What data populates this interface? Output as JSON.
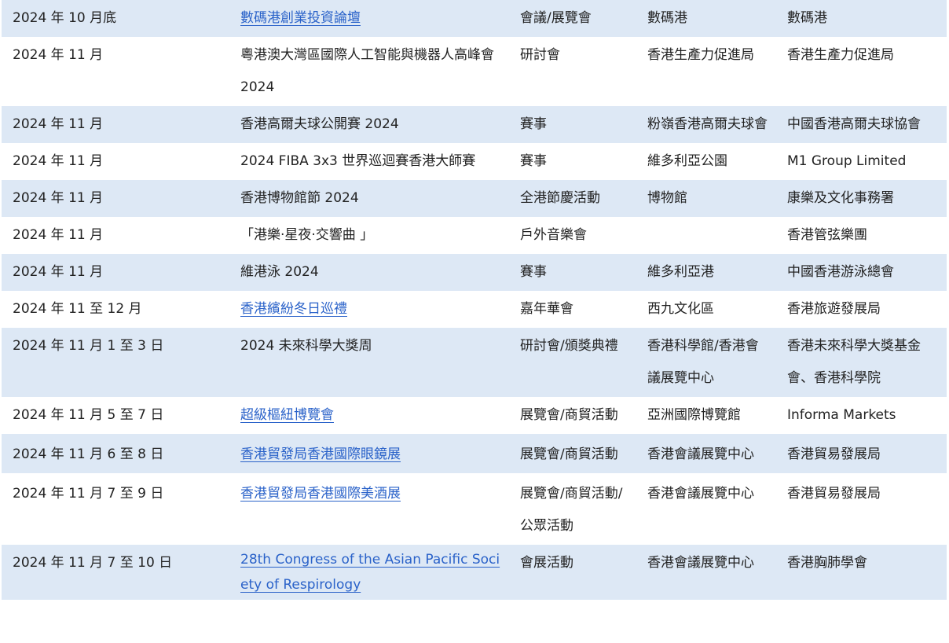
{
  "rows": [
    {
      "date": "2024 年 10 月底",
      "event": "數碼港創業投資論壇",
      "link": true,
      "type": "會議/展覽會",
      "venue": "數碼港",
      "organizer": "數碼港"
    },
    {
      "date": "2024 年 11 月",
      "event": "粵港澳大灣區國際人工智能與機器人高峰會 2024",
      "link": false,
      "type": "研討會",
      "venue": "香港生產力促進局",
      "organizer": "香港生產力促進局"
    },
    {
      "date": "2024 年 11 月",
      "event": "香港高爾夫球公開賽 2024",
      "link": false,
      "type": "賽事",
      "venue": "粉嶺香港高爾夫球會",
      "organizer": "中國香港高爾夫球協會"
    },
    {
      "date": "2024 年 11 月",
      "event": "2024 FIBA 3x3 世界巡迴賽香港大師賽",
      "link": false,
      "type": "賽事",
      "venue": "維多利亞公園",
      "organizer": "M1 Group Limited"
    },
    {
      "date": "2024 年 11 月",
      "event": "香港博物館節 2024",
      "link": false,
      "type": "全港節慶活動",
      "venue": "博物館",
      "organizer": "康樂及文化事務署"
    },
    {
      "date": "2024 年 11 月",
      "event": "「港樂‧星夜‧交響曲 」",
      "link": false,
      "type": "戶外音樂會",
      "venue": "",
      "organizer": "香港管弦樂團"
    },
    {
      "date": "2024 年 11 月",
      "event": "維港泳 2024",
      "link": false,
      "type": "賽事",
      "venue": "維多利亞港",
      "organizer": "中國香港游泳總會"
    },
    {
      "date": "2024 年 11 至 12 月",
      "event": "香港繽紛冬日巡禮",
      "link": true,
      "type": "嘉年華會",
      "venue": "西九文化區",
      "organizer": "香港旅遊發展局"
    },
    {
      "date": "2024 年 11 月 1 至 3 日",
      "event": "2024 未來科學大獎周",
      "link": false,
      "type": "研討會/頒獎典禮",
      "venue": "香港科學館/香港會議展覽中心",
      "organizer": "香港未來科學大獎基金會、香港科學院"
    },
    {
      "date": "2024 年 11 月 5 至 7 日",
      "event": "超級樞紐博覽會",
      "link": true,
      "type": "展覽會/商貿活動",
      "venue": "亞洲國際博覽館",
      "organizer": "Informa Markets"
    },
    {
      "date": "2024 年 11 月 6 至 8 日",
      "event": "香港貿發局香港國際眼鏡展",
      "link": true,
      "type": "展覽會/商貿活動",
      "venue": "香港會議展覽中心",
      "organizer": "香港貿易發展局"
    },
    {
      "date": "2024 年 11 月 7 至 9 日",
      "event": "香港貿發局香港國際美酒展",
      "link": true,
      "type": "展覽會/商貿活動/公眾活動",
      "venue": "香港會議展覽中心",
      "organizer": "香港貿易發展局"
    },
    {
      "date": "2024 年 11 月 7 至 10 日",
      "event": "28th Congress of the Asian Pacific Society of Respirology",
      "link": true,
      "type": "會展活動",
      "venue": "香港會議展覽中心",
      "organizer": "香港胸肺學會"
    }
  ]
}
